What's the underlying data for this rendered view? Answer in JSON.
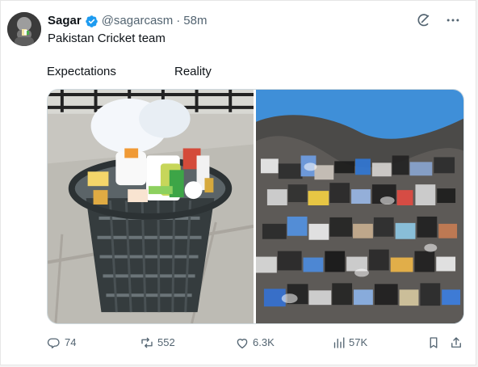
{
  "author": {
    "name": "Sagar",
    "handle": "@sagarcasm",
    "separator": "·",
    "time": "58m",
    "verified_color": "#1d9bf0"
  },
  "tweet": {
    "text": "Pakistan Cricket team"
  },
  "media": {
    "captions": {
      "left": "Expectations",
      "right": "Reality"
    }
  },
  "stats": {
    "replies": "74",
    "reposts": "552",
    "likes": "6.3K",
    "views": "57K"
  },
  "icons": {
    "grok": "grok-icon",
    "more": "more-icon",
    "reply": "reply-icon",
    "repost": "repost-icon",
    "like": "heart-icon",
    "views": "views-icon",
    "bookmark": "bookmark-icon",
    "share": "share-icon"
  },
  "colors": {
    "text": "#0f1419",
    "secondary": "#536471",
    "verified": "#1d9bf0",
    "border": "#cfd9de"
  }
}
